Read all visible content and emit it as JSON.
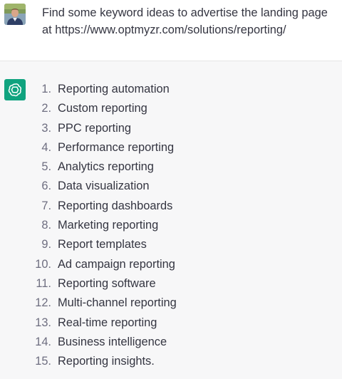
{
  "user": {
    "prompt": "Find some keyword ideas to advertise the landing page at https://www.optmyzr.com/solutions/reporting/"
  },
  "assistant": {
    "items": [
      {
        "num": "1.",
        "text": "Reporting automation"
      },
      {
        "num": "2.",
        "text": "Custom reporting"
      },
      {
        "num": "3.",
        "text": "PPC reporting"
      },
      {
        "num": "4.",
        "text": "Performance reporting"
      },
      {
        "num": "5.",
        "text": "Analytics reporting"
      },
      {
        "num": "6.",
        "text": "Data visualization"
      },
      {
        "num": "7.",
        "text": "Reporting dashboards"
      },
      {
        "num": "8.",
        "text": "Marketing reporting"
      },
      {
        "num": "9.",
        "text": "Report templates"
      },
      {
        "num": "10.",
        "text": "Ad campaign reporting"
      },
      {
        "num": "11.",
        "text": "Reporting software"
      },
      {
        "num": "12.",
        "text": "Multi-channel reporting"
      },
      {
        "num": "13.",
        "text": "Real-time reporting"
      },
      {
        "num": "14.",
        "text": "Business intelligence"
      },
      {
        "num": "15.",
        "text": "Reporting insights."
      }
    ]
  },
  "colors": {
    "assistant_avatar": "#10a37f",
    "assistant_bg": "#f7f7f8",
    "user_bg": "#ffffff",
    "text": "#343541"
  },
  "icons": {
    "user_avatar": "user-photo-avatar",
    "assistant_avatar": "openai-logo-icon"
  }
}
